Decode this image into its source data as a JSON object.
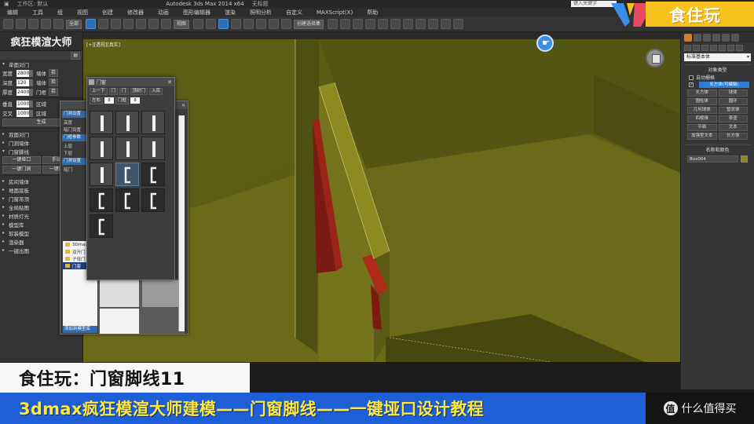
{
  "window": {
    "title": "Autodesk 3ds Max 2014 x64",
    "title_tail": "无标题",
    "workspace": "工作区: 默认",
    "search_placeholder": "键入关键字"
  },
  "menu": [
    "编辑",
    "工具",
    "组",
    "视图",
    "创建",
    "修改器",
    "动画",
    "图形编辑器",
    "渲染",
    "照明分析",
    "自定义",
    "MAXScript(X)",
    "帮助"
  ],
  "toolbar": {
    "selection_filter": "全部",
    "ref_coord": "视图",
    "named_selection": "创建选择集"
  },
  "left_panel": {
    "title": "疯狂模渲大师",
    "section_wall": "单面对门",
    "fields": [
      {
        "label": "宽度",
        "value": "2800",
        "label2": "墙体"
      },
      {
        "label": "深度",
        "value": "120",
        "label2": "墙体"
      },
      {
        "label": "厚度",
        "value": "2400",
        "label2": "门框"
      }
    ],
    "extra_fields": [
      {
        "label": "垂直",
        "value": "1000",
        "label2": "区域"
      },
      {
        "label": "交叉",
        "value": "1000",
        "label2": "区域"
      }
    ],
    "build_button": "生成",
    "sections": [
      "双面对门",
      "门洞墙体",
      "门窗脚线"
    ],
    "sub_buttons": [
      [
        "一键垭口",
        "手动垭口"
      ],
      [
        "一键门洞",
        "一键踢脚线"
      ]
    ],
    "more_sections": [
      "房间墙体",
      "地面底板",
      "门窗吊顶",
      "全局贴图",
      "材质灯光",
      "模型库",
      "软装模型",
      "渲染器",
      "一键出图"
    ]
  },
  "viewport": {
    "label": "[+][透视][真实]"
  },
  "back_dialog": {
    "rows": [
      "门洞设置",
      "高度",
      "暗门设置",
      "门框参数",
      "上层",
      "下层",
      "门洞设置",
      "暗门"
    ],
    "files": [
      "3Dmax",
      "双开门",
      "子母门",
      "门套"
    ],
    "bottom_button": "添加到模型库",
    "thumb_label": "01"
  },
  "door_dialog": {
    "title": "门窗",
    "row1": [
      "上一下",
      "门",
      "门",
      "顶封门",
      "入库"
    ],
    "row2": [
      "左右",
      "8",
      "门框",
      "8"
    ],
    "cells": [
      {
        "kind": "straight",
        "filled": true
      },
      {
        "kind": "straight",
        "filled": true
      },
      {
        "kind": "straight",
        "filled": true
      },
      {
        "kind": "straight",
        "filled": true
      },
      {
        "kind": "straight",
        "filled": true
      },
      {
        "kind": "straight",
        "filled": true
      },
      {
        "kind": "straight",
        "filled": true
      },
      {
        "kind": "bracket",
        "filled": false,
        "selected": true
      },
      {
        "kind": "bracket",
        "filled": false
      },
      {
        "kind": "bracket",
        "filled": false
      },
      {
        "kind": "bracket",
        "filled": false
      },
      {
        "kind": "bracket",
        "filled": false
      },
      {
        "kind": "bracket",
        "filled": false
      }
    ]
  },
  "right_panel": {
    "category": "标准基本体",
    "section_title": "对象类型",
    "autogrid": "自动栅格",
    "blue_button": "长方体(可编辑)",
    "buttons": [
      "长方体",
      "球体",
      "圆柱体",
      "圆环",
      "几何球体",
      "管状体",
      "四棱锥",
      "茶壶",
      "平面",
      "文本",
      "加强型文本",
      "长方体"
    ],
    "name_section": "名称和颜色",
    "object_name": "Box004",
    "object_color": "#8a8a1a"
  },
  "colors": {
    "floor": "#6a6a18",
    "wall_top": "#8b8b22",
    "wall_side": "#4c4d12",
    "door_frame": "#7a1a12",
    "caption_blue": "#1e5fd8",
    "caption_yellow": "#ffe83a",
    "watermark_yellow": "#f6c21b"
  },
  "watermark": {
    "text": "食住玩"
  },
  "captions": {
    "top": "食住玩：门窗脚线11",
    "bottom": "3dmax疯狂模渲大师建模——门窗脚线——一键垭口设计教程"
  },
  "badge": {
    "glyph": "值",
    "text": "什么值得买"
  }
}
